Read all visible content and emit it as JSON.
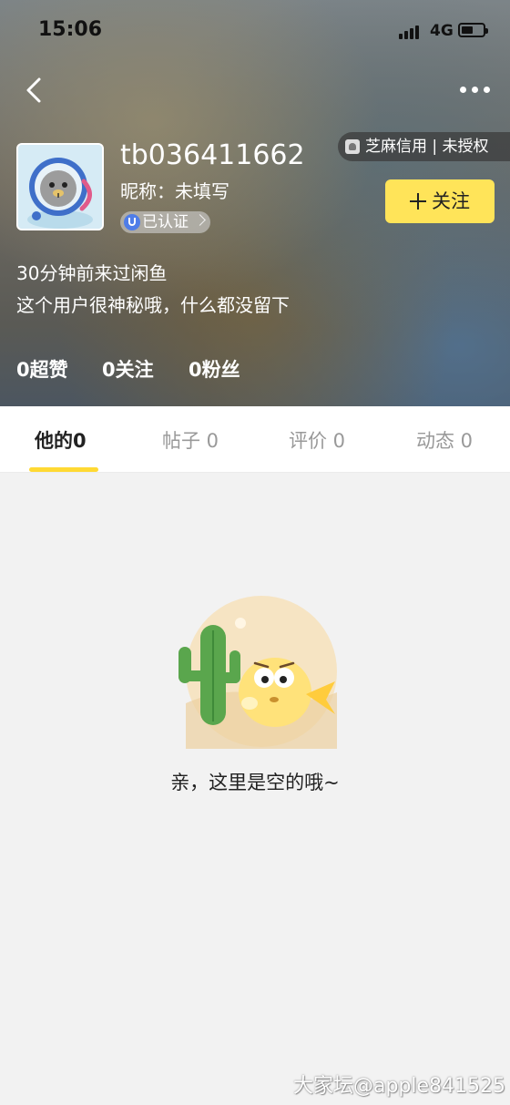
{
  "status_bar": {
    "time": "15:06",
    "network": "4G"
  },
  "header": {
    "credit_badge": "芝麻信用 | 未授权",
    "username": "tb036411662",
    "nickname": "昵称：未填写",
    "verified_label": "已认证",
    "follow_label": "关注",
    "last_seen": "30分钟前来过闲鱼",
    "bio": "这个用户很神秘哦，什么都没留下",
    "stats": {
      "likes": "0超赞",
      "following": "0关注",
      "fans": "0粉丝"
    }
  },
  "tabs": [
    {
      "label": "他的0",
      "active": true
    },
    {
      "label": "帖子 0",
      "active": false
    },
    {
      "label": "评价 0",
      "active": false
    },
    {
      "label": "动态 0",
      "active": false
    }
  ],
  "empty_state": {
    "message": "亲，这里是空的哦~"
  },
  "watermark": "大家坛@apple841525",
  "colors": {
    "accent": "#ffe459",
    "tab_indicator": "#ffd933",
    "background": "#f2f2f2"
  }
}
